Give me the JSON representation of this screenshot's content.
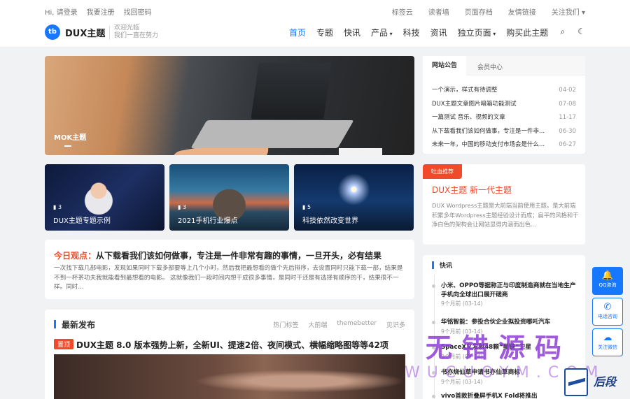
{
  "topbar": {
    "greeting": "Hi, 请登录",
    "register": "我要注册",
    "find_password": "找回密码",
    "right_links": [
      "标签云",
      "读者墙",
      "页面存档",
      "友情链接",
      "关注我们 ▾"
    ]
  },
  "header": {
    "logo_badge": "tb",
    "logo_text": "DUX主题",
    "tagline_1": "欢迎光临",
    "tagline_2": "我们一直在努力",
    "nav": [
      "首页",
      "专题",
      "快讯",
      "产品",
      "科技",
      "资讯",
      "独立页面",
      "购买此主题"
    ],
    "search_icon": "⌕",
    "theme_icon": "☾"
  },
  "hero": {
    "title": "MOK主题"
  },
  "thumbs": [
    {
      "count": "▮ 3",
      "label": "DUX主题专题示例"
    },
    {
      "count": "▮ 3",
      "label": "2021手机行业爆点"
    },
    {
      "count": "▮ 5",
      "label": "科技依然改变世界"
    }
  ],
  "opinion": {
    "prefix": "今日观点：",
    "title": "从下载看我们该如何做事，专注是一件非常有趣的事情，一旦开头，必有结果",
    "text": "一次找下载几部电影，发现如果同时下载多部要等上几个小时，然后我把最想看的做个先后排序，去设置同时只能下载一部，结果是不到一杯茶功夫我就能看到最想看的电影。 这就像我们一段时间内想干成很多事情，是同时干还是有选择有顺序的干，结果很不一样。同时..."
  },
  "latest": {
    "heading": "最新发布",
    "tags": [
      "热门标签",
      "大前端",
      "themebetter",
      "见识多"
    ],
    "badge": "置顶",
    "post_title": "DUX主题 8.0 版本强势上新，全新UI、提速2倍、夜间模式、横幅缩略图等等42项"
  },
  "notice": {
    "tab_1": "网站公告",
    "tab_2": "会员中心",
    "items": [
      {
        "text": "一个演示，样式有待调整",
        "date": "04-02"
      },
      {
        "text": "DUX主题文章图片暗箱功能测试",
        "date": "07-08"
      },
      {
        "text": "一篇测试 音乐、视频的文章",
        "date": "11-17"
      },
      {
        "text": "从下载看我们该如何做事，专注是一件非...",
        "date": "06-30"
      },
      {
        "text": "未来一年，中国的移动支付市场会是什么...",
        "date": "06-27"
      }
    ]
  },
  "promo": {
    "label": "吐血推荐",
    "title": "DUX主题 新一代主题",
    "desc": "DUX Wordpress主题是大前端当前使用主题，是大前端积累多年Wordpress主题经验设计而成；扁平的风格和干净白色的架构会让网站显得内涵而出色..."
  },
  "flash": {
    "heading": "快讯",
    "items": [
      {
        "title": "小米、OPPO等据称正与印度制造商就在当地生产手机向全球出口展开磋商",
        "date": "9个月前 (03-14)"
      },
      {
        "title": "华铭智能：参投合伙企业拟投资哪吒汽车",
        "date": "9个月前 (03-14)"
      },
      {
        "title": "SpaceX又发射48颗“星链”卫星",
        "date": "9个月前 (03-14)"
      },
      {
        "title": "书亦烧仙草申请书亦仙草商标",
        "date": "9个月前 (03-14)"
      },
      {
        "title": "vivo首款折叠屏手机X Fold将推出",
        "date": ""
      }
    ]
  },
  "floating": [
    {
      "icon": "🔔",
      "label": "QQ咨询"
    },
    {
      "icon": "✆",
      "label": "电话咨询"
    },
    {
      "icon": "☁",
      "label": "关注微信"
    }
  ],
  "watermark": {
    "big": "无错源码",
    "small": "WUCUOYM.COM",
    "script": "后段"
  },
  "colors": {
    "accent": "#1677ff",
    "highlight": "#f04a2b"
  }
}
